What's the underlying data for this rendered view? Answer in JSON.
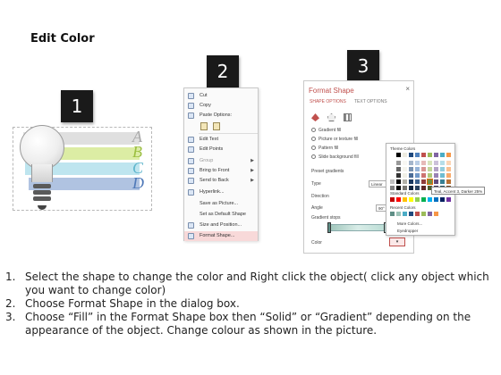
{
  "title": "Edit Color",
  "steps": {
    "one": "1",
    "two": "2",
    "three": "3"
  },
  "panel1": {
    "bands": [
      {
        "label": "A",
        "color": "#dcdcdc",
        "text_color": "#a9a9a9"
      },
      {
        "label": "B",
        "color": "#d9ec9c",
        "text_color": "#9bbf3f"
      },
      {
        "label": "C",
        "color": "#b9e3ee",
        "text_color": "#5fb5cc"
      },
      {
        "label": "D",
        "color": "#a9bede",
        "text_color": "#4f79b8"
      }
    ]
  },
  "context_menu": {
    "cut": "Cut",
    "copy": "Copy",
    "paste_options": "Paste Options:",
    "edit_text": "Edit Text",
    "edit_points": "Edit Points",
    "group": "Group",
    "bring_to_front": "Bring to Front",
    "send_to_back": "Send to Back",
    "hyperlink": "Hyperlink...",
    "save_as_picture": "Save as Picture...",
    "set_as_default_shape": "Set as Default Shape",
    "size_and_position": "Size and Position...",
    "format_shape": "Format Shape..."
  },
  "format_pane": {
    "title": "Format Shape",
    "close": "×",
    "tab_shape_options": "SHAPE OPTIONS",
    "tab_text_options": "TEXT OPTIONS",
    "gradient_fill": "Gradient fill",
    "picture_or_texture_fill": "Picture or texture fill",
    "pattern_fill": "Pattern fill",
    "slide_background_fill": "Slide background fill",
    "preset_gradients": "Preset gradients",
    "type": "Type",
    "type_value": "Linear",
    "direction": "Direction",
    "angle": "Angle",
    "angle_value": "90°",
    "gradient_stops": "Gradient stops",
    "color": "Color"
  },
  "color_flyout": {
    "theme_colors": "Theme Colors",
    "standard_colors": "Standard Colors",
    "recent_colors": "Recent Colors",
    "more_colors": "More Colors...",
    "eyedropper": "Eyedropper",
    "tooltip": "Teal, Accent 3, Darker 25%",
    "theme_top_row": [
      "#ffffff",
      "#000000",
      "#eeece1",
      "#1f497d",
      "#4f81bd",
      "#c0504d",
      "#9bbb59",
      "#8064a2",
      "#4bacc6",
      "#f79646"
    ],
    "standard_row": [
      "#c00000",
      "#ff0000",
      "#ffc000",
      "#ffff00",
      "#92d050",
      "#00b050",
      "#00b0f0",
      "#0070c0",
      "#002060",
      "#7030a0"
    ],
    "recent_row": [
      "#5f8e86",
      "#9cc3b8",
      "#4bacc6",
      "#1f497d",
      "#c0504d",
      "#9bbb59",
      "#8064a2",
      "#f79646"
    ]
  },
  "instructions": [
    {
      "num": "1.",
      "text": "Select the shape to change the color and Right click the object( click any object which you want to change color)"
    },
    {
      "num": "2.",
      "text": "Choose Format Shape in the dialog box."
    },
    {
      "num": "3.",
      "text": "Choose “Fill” in the Format Shape box then “Solid” or “Gradient” depending on the appearance of the object. Change colour as shown in the picture."
    }
  ]
}
